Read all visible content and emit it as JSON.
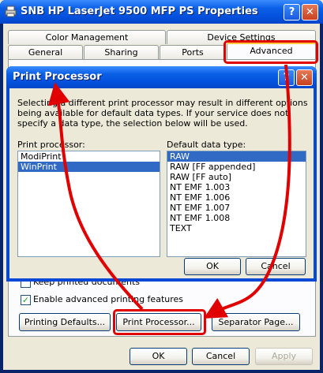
{
  "window": {
    "title": "SNB HP LaserJet 9500 MFP PS Properties",
    "help_glyph": "?",
    "close_glyph": "✕"
  },
  "tabs": {
    "row_back": [
      "Color Management",
      "Device Settings"
    ],
    "row_front": [
      "General",
      "Sharing",
      "Ports",
      "Advanced"
    ]
  },
  "advanced": {
    "keep_printed_label": "Keep printed documents",
    "enable_advanced_label": "Enable advanced printing features",
    "enable_advanced_checked": true,
    "printing_defaults_label": "Printing Defaults...",
    "print_processor_label": "Print Processor...",
    "separator_page_label": "Separator Page..."
  },
  "footer": {
    "ok_label": "OK",
    "cancel_label": "Cancel",
    "apply_label": "Apply"
  },
  "dialog": {
    "title": "Print Processor",
    "help_glyph": "?",
    "close_glyph": "✕",
    "description": "Selecting a different print processor may result in different options being available for default data types. If your service does not specify a data type, the selection below will be used.",
    "processor_label": "Print processor:",
    "processors": [
      "ModiPrint",
      "WinPrint"
    ],
    "processor_selected": "WinPrint",
    "datatype_label": "Default data type:",
    "datatypes": [
      "RAW",
      "RAW [FF appended]",
      "RAW [FF auto]",
      "NT EMF 1.003",
      "NT EMF 1.006",
      "NT EMF 1.007",
      "NT EMF 1.008",
      "TEXT"
    ],
    "datatype_selected": "RAW",
    "ok_label": "OK",
    "cancel_label": "Cancel"
  },
  "annotation_color": "#E00000"
}
